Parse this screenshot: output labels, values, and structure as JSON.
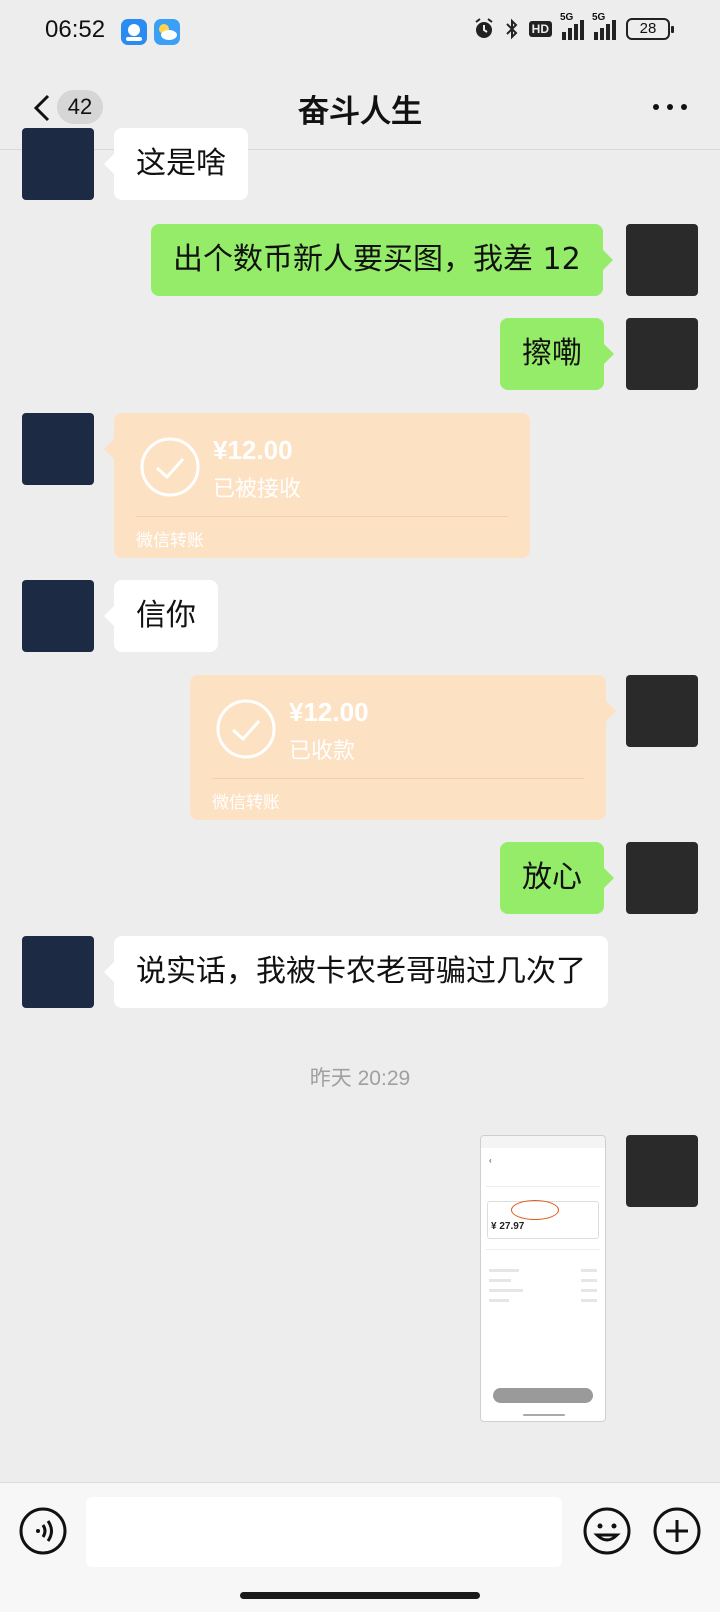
{
  "status_bar": {
    "time": "06:52",
    "battery": "28",
    "hd_label": "HD",
    "signal_1": "5G",
    "signal_2": "5G"
  },
  "header": {
    "unread_count": "42",
    "title": "奋斗人生",
    "back_icon": "chevron-left-icon",
    "more_icon": "more-dots-icon"
  },
  "messages": [
    {
      "side": "in",
      "type": "text",
      "text": "这是啥"
    },
    {
      "side": "out",
      "type": "text",
      "text": "出个数币新人要买图，我差 12"
    },
    {
      "side": "out",
      "type": "text",
      "text": "擦嘞"
    },
    {
      "side": "in",
      "type": "transfer",
      "amount": "¥12.00",
      "status": "已被接收",
      "footer": "微信转账"
    },
    {
      "side": "in",
      "type": "text",
      "text": "信你"
    },
    {
      "side": "out",
      "type": "transfer",
      "amount": "¥12.00",
      "status": "已收款",
      "footer": "微信转账"
    },
    {
      "side": "out",
      "type": "text",
      "text": "放心"
    },
    {
      "side": "in",
      "type": "text",
      "text": "说实话，我被卡农老哥骗过几次了"
    },
    {
      "side": "system",
      "type": "timestamp",
      "text": "昨天 20:29"
    },
    {
      "side": "out",
      "type": "image",
      "amount": "¥ 27.97"
    }
  ],
  "colors": {
    "background": "#ededed",
    "outgoing_bubble": "#95ec69",
    "incoming_bubble": "#ffffff",
    "transfer_card": "#fde1c3",
    "highlight_ring": "#e05a1a"
  },
  "input_bar": {
    "voice_icon": "voice-icon",
    "emoji_icon": "emoji-icon",
    "add_icon": "plus-circle-icon"
  }
}
